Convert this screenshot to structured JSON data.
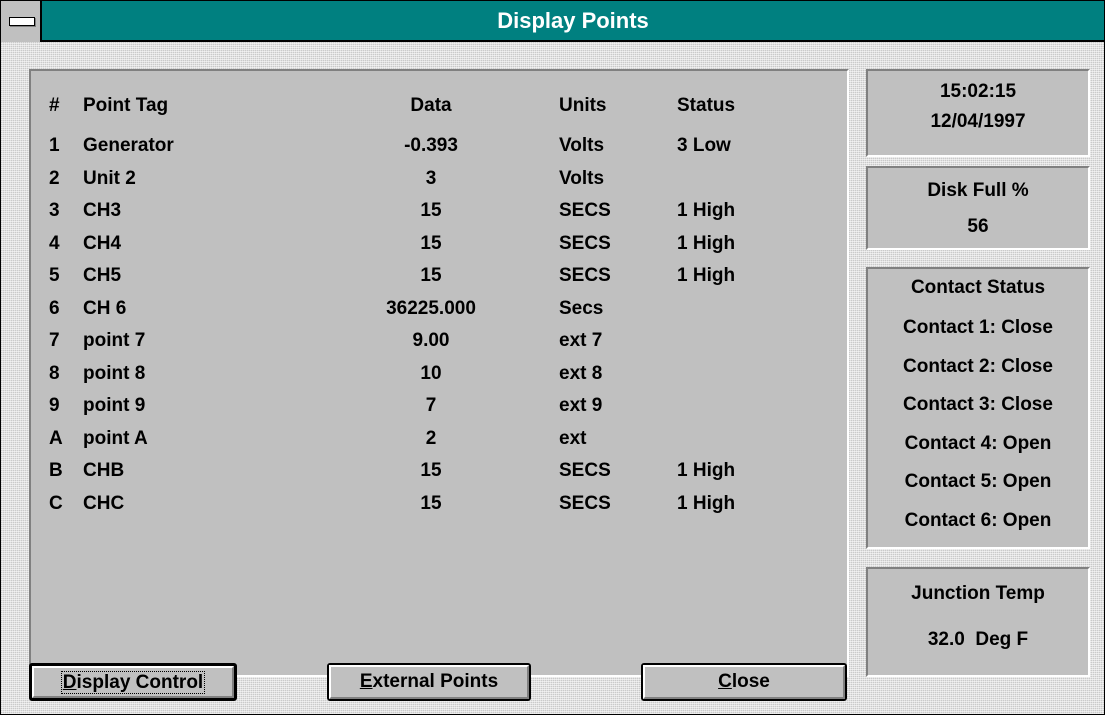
{
  "window": {
    "title": "Display Points"
  },
  "table": {
    "headers": {
      "num": "#",
      "tag": "Point Tag",
      "data": "Data",
      "units": "Units",
      "status": "Status"
    },
    "rows": [
      {
        "num": "1",
        "tag": "Generator",
        "data": "-0.393",
        "units": "Volts",
        "status": "3 Low"
      },
      {
        "num": "2",
        "tag": "Unit 2",
        "data": "3",
        "units": "Volts",
        "status": ""
      },
      {
        "num": "3",
        "tag": "CH3",
        "data": "15",
        "units": "SECS",
        "status": "1 High"
      },
      {
        "num": "4",
        "tag": "CH4",
        "data": "15",
        "units": "SECS",
        "status": "1 High"
      },
      {
        "num": "5",
        "tag": "CH5",
        "data": "15",
        "units": "SECS",
        "status": "1 High"
      },
      {
        "num": "6",
        "tag": "CH 6",
        "data": "36225.000",
        "units": "Secs",
        "status": ""
      },
      {
        "num": "7",
        "tag": "point 7",
        "data": "9.00",
        "units": "ext 7",
        "status": ""
      },
      {
        "num": "8",
        "tag": "point 8",
        "data": "10",
        "units": "ext 8",
        "status": ""
      },
      {
        "num": "9",
        "tag": "point 9",
        "data": "7",
        "units": "ext 9",
        "status": ""
      },
      {
        "num": "A",
        "tag": "point A",
        "data": "2",
        "units": "ext",
        "status": ""
      },
      {
        "num": "B",
        "tag": "CHB",
        "data": "15",
        "units": "SECS",
        "status": "1 High"
      },
      {
        "num": "C",
        "tag": "CHC",
        "data": "15",
        "units": "SECS",
        "status": "1 High"
      }
    ]
  },
  "clock": {
    "time": "15:02:15",
    "date": "12/04/1997"
  },
  "disk": {
    "label": "Disk Full %",
    "value": "56"
  },
  "contacts": {
    "title": "Contact Status",
    "items": [
      "Contact 1: Close",
      "Contact 2: Close",
      "Contact 3: Close",
      "Contact 4: Open",
      "Contact 5: Open",
      "Contact 6: Open"
    ]
  },
  "junction": {
    "label": "Junction Temp",
    "value": "32.0  Deg F"
  },
  "buttons": {
    "display_control": {
      "mnemonic": "D",
      "rest": "isplay Control"
    },
    "external_points": {
      "mnemonic": "E",
      "rest": "xternal Points"
    },
    "close": {
      "mnemonic": "C",
      "rest": "lose"
    }
  }
}
